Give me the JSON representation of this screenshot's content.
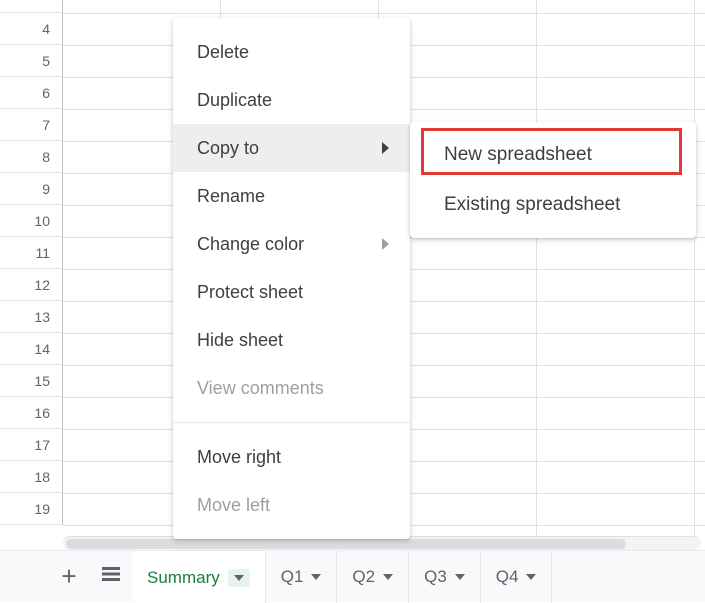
{
  "rows": [
    "",
    "4",
    "5",
    "6",
    "7",
    "8",
    "9",
    "10",
    "11",
    "12",
    "13",
    "14",
    "15",
    "16",
    "17",
    "18",
    "19"
  ],
  "context_menu": {
    "delete": "Delete",
    "duplicate": "Duplicate",
    "copy_to": "Copy to",
    "rename": "Rename",
    "change_color": "Change color",
    "protect_sheet": "Protect sheet",
    "hide_sheet": "Hide sheet",
    "view_comments": "View comments",
    "move_right": "Move right",
    "move_left": "Move left"
  },
  "submenu": {
    "new_spreadsheet": "New spreadsheet",
    "existing_spreadsheet": "Existing spreadsheet"
  },
  "tabs": {
    "active": "Summary",
    "others": [
      "Q1",
      "Q2",
      "Q3",
      "Q4"
    ]
  }
}
